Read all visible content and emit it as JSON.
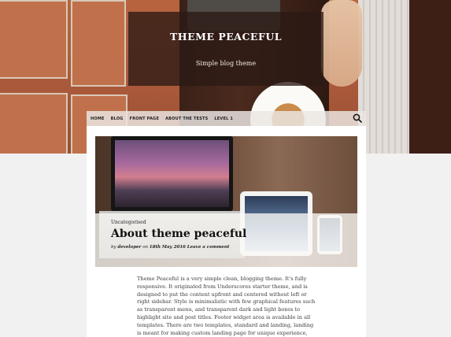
{
  "site": {
    "title": "THEME PEACEFUL",
    "description": "Simple blog theme"
  },
  "nav": {
    "items": [
      "HOME",
      "BLOG",
      "FRONT PAGE",
      "ABOUT THE TESTS",
      "LEVEL 1"
    ],
    "search_icon": "search-icon"
  },
  "post": {
    "category": "Uncategorised",
    "title": "About theme peaceful",
    "meta": {
      "by": "by",
      "author": "developer",
      "on": "on",
      "date": "18th May 2016",
      "comment": "Leave a comment"
    },
    "excerpt": "Theme Peaceful is a very simple clean, blogging theme. It's fully responsive. It originated from Underscores starter theme, and is designed to put the content upfront and centered without left or right sidebar. Style is minimalistic with few graphical features such as transparent menu, and transparent dark and light boxes to highlight site and post titles. Footer widget area is available in all templates. There are two templates, standard and landing, landing is meant for making custom landing page for unique experience, and is"
  },
  "colors": {
    "page_bg": "#f1f1f1",
    "title_box": "#2c1a14",
    "nav_bg": "#ebe6e2"
  }
}
